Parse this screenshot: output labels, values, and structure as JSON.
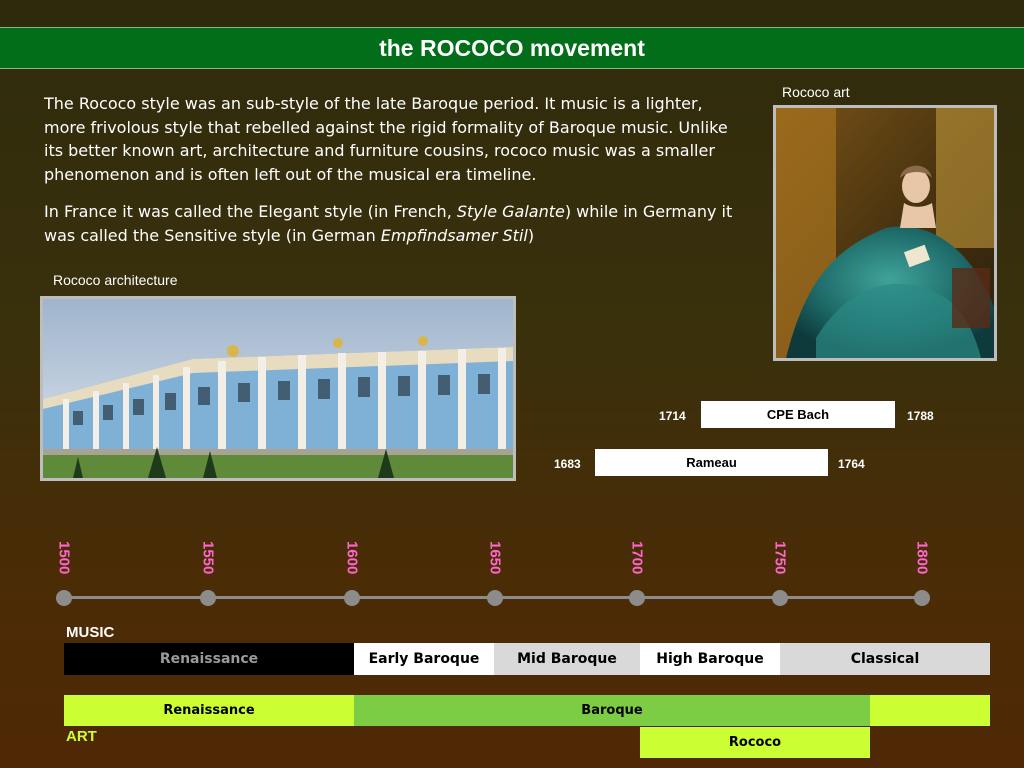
{
  "title": "the ROCOCO movement",
  "paragraph1": "The Rococo style was an sub-style of the late Baroque period. It music is a lighter, more frivolous style that rebelled against the rigid formality of Baroque music. Unlike its better known art, architecture and furniture cousins, rococo music was a smaller phenomenon and  is often left out of the musical era timeline.",
  "paragraph2": {
    "part1": "In France it was called the Elegant style (in French, ",
    "italic1": "Style Galante",
    "part2": ") while in Germany it was called the Sensitive style (in German ",
    "italic2": "Empfindsamer Stil",
    "part3": ")"
  },
  "captions": {
    "art": "Rococo art",
    "architecture": "Rococo architecture"
  },
  "composers": [
    {
      "name": "CPE Bach",
      "start": "1714",
      "end": "1788"
    },
    {
      "name": "Rameau",
      "start": "1683",
      "end": "1764"
    }
  ],
  "timeline": {
    "years": [
      "1500",
      "1550",
      "1600",
      "1650",
      "1700",
      "1750",
      "1800"
    ]
  },
  "music": {
    "label": "MUSIC",
    "eras": [
      "Renaissance",
      "Early Baroque",
      "Mid Baroque",
      "High Baroque",
      "Classical"
    ]
  },
  "art": {
    "label": "ART",
    "eras": [
      "Renaissance",
      "Baroque",
      "Rococo"
    ]
  },
  "colors": {
    "title_bar": "#036e1a",
    "year_text": "#ff66cc",
    "art_green": "#ccff33",
    "baroque_green": "#7ccc44"
  }
}
